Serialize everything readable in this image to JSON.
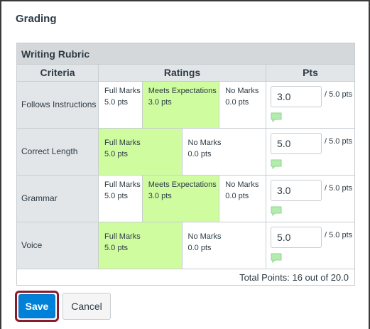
{
  "section_title": "Grading",
  "rubric": {
    "title": "Writing Rubric",
    "columns": {
      "criteria": "Criteria",
      "ratings": "Ratings",
      "pts": "Pts"
    },
    "rows": [
      {
        "criterion": "Follows Instructions",
        "ratings": [
          {
            "label": "Full Marks",
            "points": "5.0 pts",
            "selected": false
          },
          {
            "label": "Meets Expectations",
            "points": "3.0 pts",
            "selected": true
          },
          {
            "label": "No Marks",
            "points": "0.0 pts",
            "selected": false
          }
        ],
        "score": "3.0",
        "max": "/ 5.0 pts"
      },
      {
        "criterion": "Correct Length",
        "ratings": [
          {
            "label": "Full Marks",
            "points": "5.0 pts",
            "selected": true
          },
          {
            "label": "No Marks",
            "points": "0.0 pts",
            "selected": false
          }
        ],
        "score": "5.0",
        "max": "/ 5.0 pts"
      },
      {
        "criterion": "Grammar",
        "ratings": [
          {
            "label": "Full Marks",
            "points": "5.0 pts",
            "selected": false
          },
          {
            "label": "Meets Expectations",
            "points": "3.0 pts",
            "selected": true
          },
          {
            "label": "No Marks",
            "points": "0.0 pts",
            "selected": false
          }
        ],
        "score": "3.0",
        "max": "/ 5.0 pts"
      },
      {
        "criterion": "Voice",
        "ratings": [
          {
            "label": "Full Marks",
            "points": "5.0 pts",
            "selected": true
          },
          {
            "label": "No Marks",
            "points": "0.0 pts",
            "selected": false
          }
        ],
        "score": "5.0",
        "max": "/ 5.0 pts"
      }
    ],
    "total": "Total Points: 16 out of 20.0"
  },
  "buttons": {
    "save": "Save",
    "cancel": "Cancel"
  },
  "colors": {
    "selected_rating": "#d0fca0",
    "save_button": "#0081d9",
    "focus_outline": "#8b1b2b",
    "comment_icon": "#b4ecb0"
  }
}
